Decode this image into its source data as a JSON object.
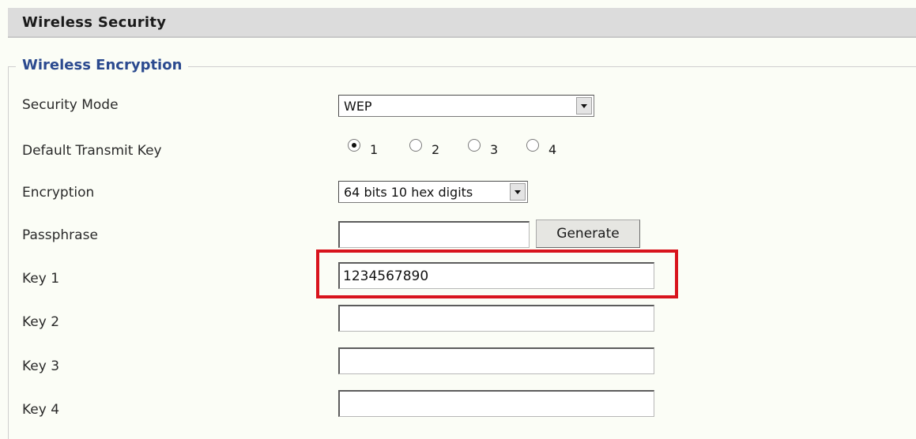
{
  "header": {
    "title": "Wireless Security"
  },
  "section": {
    "legend": "Wireless Encryption"
  },
  "fields": {
    "security_mode": {
      "label": "Security Mode",
      "value": "WEP"
    },
    "default_transmit_key": {
      "label": "Default Transmit Key",
      "options": [
        "1",
        "2",
        "3",
        "4"
      ],
      "selected": "1"
    },
    "encryption": {
      "label": "Encryption",
      "value": "64 bits 10 hex digits"
    },
    "passphrase": {
      "label": "Passphrase",
      "value": "",
      "generate_label": "Generate"
    },
    "key1": {
      "label": "Key 1",
      "value": "1234567890"
    },
    "key2": {
      "label": "Key 2",
      "value": ""
    },
    "key3": {
      "label": "Key 3",
      "value": ""
    },
    "key4": {
      "label": "Key 4",
      "value": ""
    }
  },
  "icons": {
    "dropdown": "chevron-down-icon",
    "radio": "radio-icon"
  },
  "colors": {
    "legend_text": "#2b4a8f",
    "header_bg": "#dcdcdc",
    "highlight": "#d8141d"
  }
}
